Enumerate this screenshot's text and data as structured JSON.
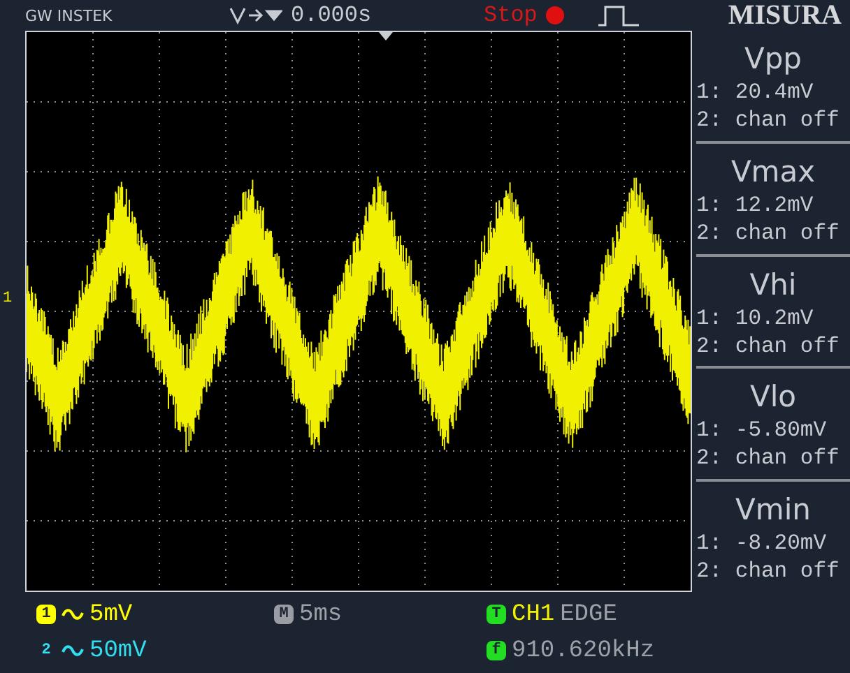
{
  "header": {
    "brand": "GW INSTEK",
    "delay": "0.000s",
    "run_state": "Stop",
    "label": "MISURA"
  },
  "graticule": {
    "channel_marker": "1"
  },
  "measurements": [
    {
      "name": "Vpp",
      "lines": [
        "1: 20.4mV",
        "2: chan off"
      ]
    },
    {
      "name": "Vmax",
      "lines": [
        "1: 12.2mV",
        "2: chan off"
      ]
    },
    {
      "name": "Vhi",
      "lines": [
        "1: 10.2mV",
        "2: chan off"
      ]
    },
    {
      "name": "Vlo",
      "lines": [
        "1: -5.80mV",
        "2: chan off"
      ]
    },
    {
      "name": "Vmin",
      "lines": [
        "1: -8.20mV",
        "2: chan off"
      ]
    }
  ],
  "status": {
    "channels": [
      {
        "badge": "1",
        "value": "5mV",
        "color": "#ffff00"
      },
      {
        "badge": "2",
        "value": "50mV",
        "color": "#33ddee"
      }
    ],
    "timebase": {
      "badge": "M",
      "value": "5ms"
    },
    "trigger": {
      "badge": "T",
      "source": "CH1",
      "type": "EDGE"
    },
    "frequency": {
      "badge": "f",
      "value": "910.620kHz"
    }
  }
}
